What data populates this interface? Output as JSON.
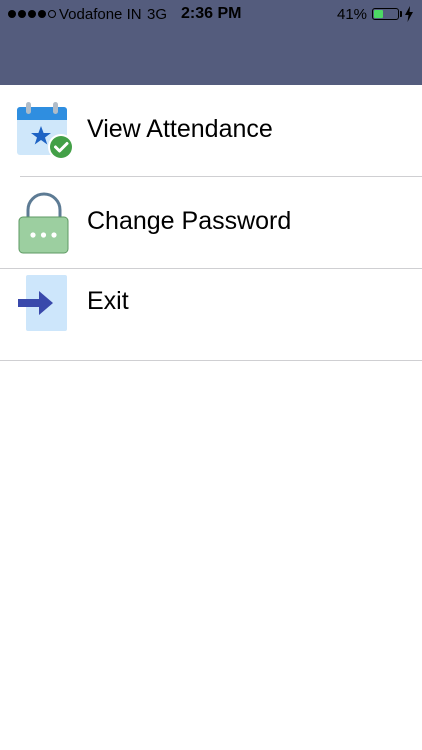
{
  "status_bar": {
    "signal_bars": 5,
    "signal_filled": 4,
    "carrier": "Vodafone IN",
    "network": "3G",
    "time": "2:36 PM",
    "battery_percent_label": "41%",
    "battery_level": 0.41,
    "charging": true
  },
  "colors": {
    "header": "#545c7d",
    "battery_fill": "#4cd964",
    "calendar_blue": "#2f8ee0",
    "check_green": "#43a047",
    "lock_green": "#9ccfa0",
    "exit_arrow": "#3949ab",
    "exit_panel": "#cde6fb"
  },
  "menu": {
    "items": [
      {
        "label": "View Attendance",
        "icon": "calendar-check-icon"
      },
      {
        "label": "Change Password",
        "icon": "lock-icon"
      },
      {
        "label": "Exit",
        "icon": "exit-arrow-icon"
      }
    ]
  }
}
